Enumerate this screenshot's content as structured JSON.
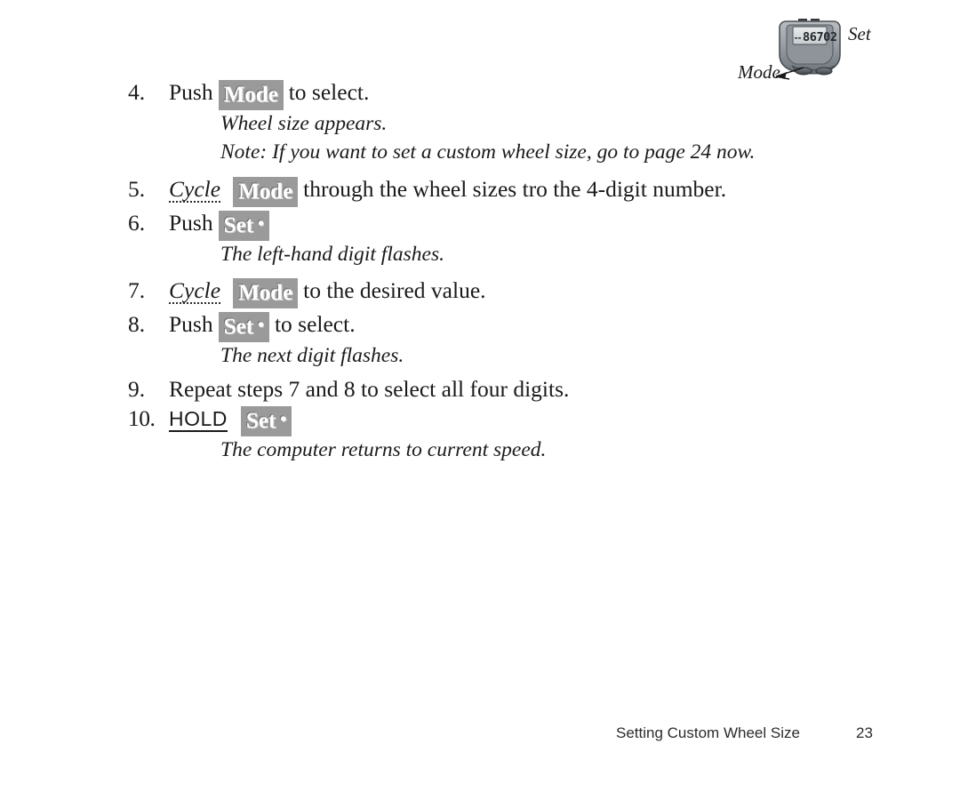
{
  "figure": {
    "name": "bike-computer-illustration",
    "display_value": "86702",
    "label_set": "Set",
    "label_mode": "Mode"
  },
  "steps": [
    {
      "number": "4.",
      "lead": "Push",
      "key": "Mode",
      "key_bullet": "",
      "trail": "to select.",
      "notes": [
        "Wheel size appears.",
        "Note: If you want to set a custom wheel size, go to page 24 now."
      ]
    },
    {
      "number": "5.",
      "cue": "Cycle",
      "key": "Mode",
      "key_bullet": "",
      "trail": "through the wheel sizes tro the 4-digit number.",
      "notes": []
    },
    {
      "number": "6.",
      "lead": "Push",
      "key": "Set",
      "key_bullet": "•",
      "trail": "",
      "notes": [
        "The left-hand digit flashes."
      ]
    },
    {
      "number": "7.",
      "cue": "Cycle",
      "key": "Mode",
      "key_bullet": "",
      "trail": "to the desired value.",
      "notes": []
    },
    {
      "number": "8.",
      "lead": "Push",
      "key": "Set",
      "key_bullet": "•",
      "trail": "to select.",
      "notes": [
        "The next digit flashes."
      ]
    },
    {
      "number": "9.",
      "lead": "Repeat steps 7 and 8 to select all four digits.",
      "notes": []
    },
    {
      "number": "10.",
      "hold": "HOLD",
      "key": "Set",
      "key_bullet": "•",
      "trail": "",
      "notes": [
        "The computer returns to current speed."
      ]
    }
  ],
  "footer": {
    "title": "Setting Custom Wheel Size",
    "page": "23"
  },
  "colors": {
    "key_badge_bg": "#9a9a9a",
    "key_badge_text": "#ffffff",
    "body_text": "#1a1a1a",
    "footer_text": "#2b2b2b"
  }
}
